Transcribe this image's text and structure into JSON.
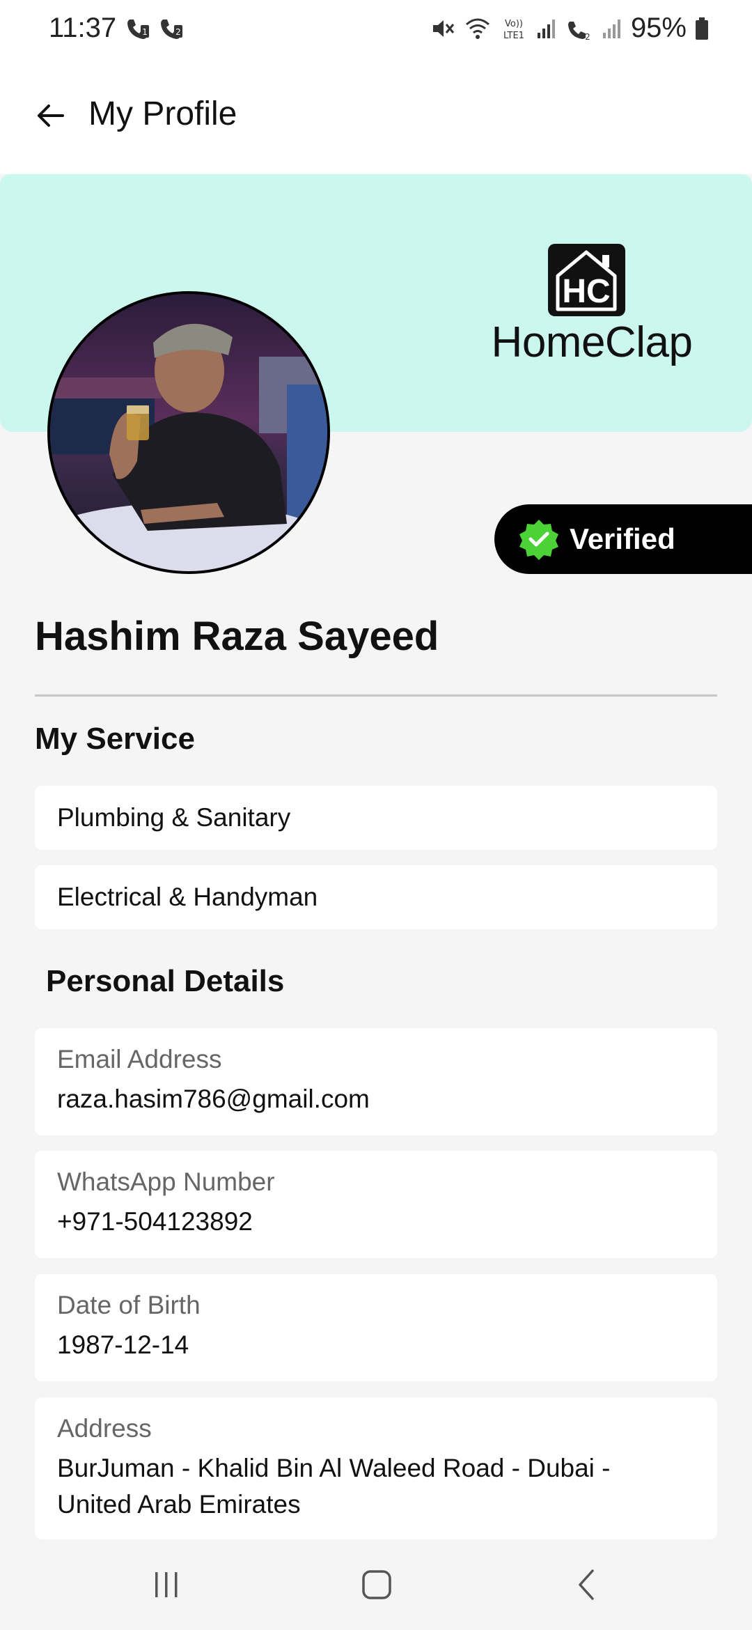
{
  "status_bar": {
    "time": "11:37",
    "battery": "95%"
  },
  "header": {
    "title": "My Profile",
    "back_icon": "arrow-left-icon"
  },
  "brand": {
    "badge_text": "HC",
    "name": "HomeClap",
    "banner_color": "#ccf7ef"
  },
  "profile": {
    "name": "Hashim Raza Sayeed",
    "verified_label": "Verified",
    "verified_color": "#4cd137"
  },
  "services": {
    "title": "My Service",
    "items": [
      "Plumbing & Sanitary",
      "Electrical & Handyman"
    ]
  },
  "personal_details": {
    "title": "Personal Details",
    "fields": [
      {
        "label": "Email Address",
        "value": "raza.hasim786@gmail.com"
      },
      {
        "label": "WhatsApp Number",
        "value": "+971-504123892"
      },
      {
        "label": "Date of Birth",
        "value": "1987-12-14"
      },
      {
        "label": "Address",
        "value": "BurJuman - Khalid Bin Al Waleed Road - Dubai -",
        "value_line2": "United Arab Emirates"
      }
    ]
  },
  "nav": {
    "recents_icon": "recent-apps-icon",
    "home_icon": "home-icon",
    "back_icon": "nav-back-icon"
  }
}
